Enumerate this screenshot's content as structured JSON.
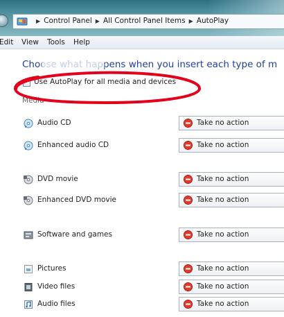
{
  "address_bar": {
    "crumbs": [
      "Control Panel",
      "All Control Panel Items",
      "AutoPlay"
    ]
  },
  "menu": {
    "items": [
      "Edit",
      "View",
      "Tools",
      "Help"
    ]
  },
  "main": {
    "heading": "Choose what happens when you insert each type of m",
    "autoplay_checkbox_label": "Use AutoPlay for all media and devices",
    "autoplay_checked": false,
    "media_header": "Media"
  },
  "media_rows": [
    {
      "label": "Audio CD",
      "action": "Take no action",
      "icon": "audio-cd-icon"
    },
    {
      "label": "Enhanced audio CD",
      "action": "Take no action",
      "icon": "enhanced-audio-cd-icon"
    },
    {
      "label": "DVD movie",
      "action": "Take no action",
      "icon": "dvd-movie-icon"
    },
    {
      "label": "Enhanced DVD movie",
      "action": "Take no action",
      "icon": "enhanced-dvd-icon"
    },
    {
      "label": "Software and games",
      "action": "Take no action",
      "icon": "software-games-icon"
    },
    {
      "label": "Pictures",
      "action": "Take no action",
      "icon": "pictures-icon"
    },
    {
      "label": "Video files",
      "action": "Take no action",
      "icon": "video-files-icon"
    },
    {
      "label": "Audio files",
      "action": "Take no action",
      "icon": "audio-files-icon"
    }
  ],
  "colors": {
    "heading": "#1e3f9c",
    "annotation_ellipse": "#e3001b"
  }
}
